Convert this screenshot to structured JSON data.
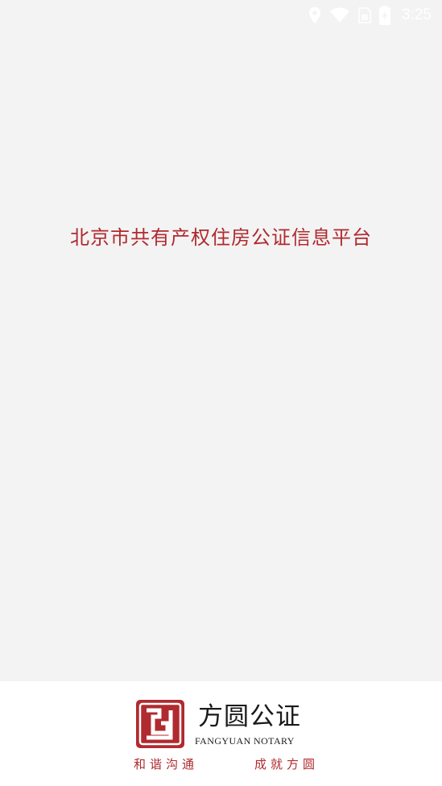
{
  "status_bar": {
    "time": "3:25",
    "icons": [
      "location-icon",
      "wifi-icon",
      "sim-icon",
      "battery-charging-icon"
    ]
  },
  "main": {
    "title": "北京市共有产权住房公证信息平台"
  },
  "footer": {
    "brand_name": "方圆公证",
    "brand_name_en": "FANGYUAN NOTARY",
    "slogan_left": "和谐沟通",
    "slogan_right": "成就方圆",
    "seal_char": "㘝"
  },
  "colors": {
    "background": "#f3f3f3",
    "accent_red": "#b02a2f",
    "footer_bg": "#ffffff",
    "status_icons": "#ffffff"
  }
}
